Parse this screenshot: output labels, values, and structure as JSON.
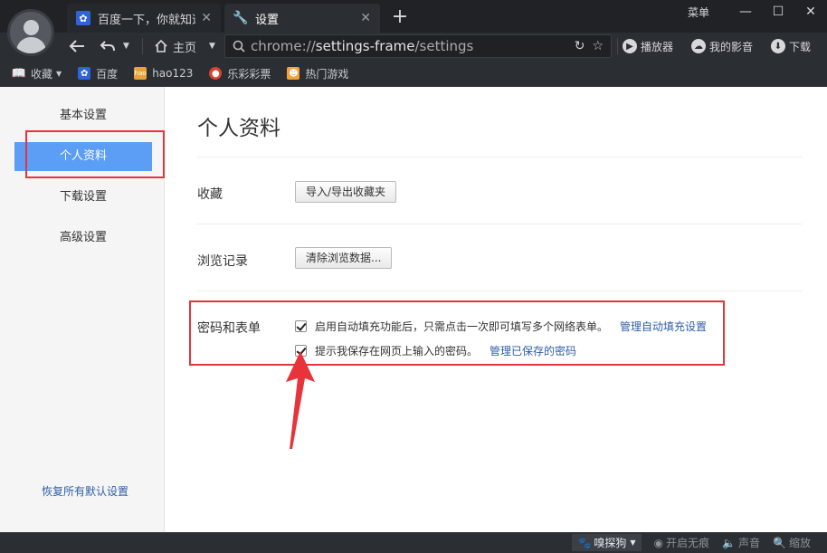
{
  "tabs": [
    {
      "title": "百度一下，你就知道",
      "favicon": "baidu-paw-icon",
      "active": false
    },
    {
      "title": "设置",
      "favicon": "wrench-icon",
      "active": true
    }
  ],
  "window": {
    "menu_label": "菜单"
  },
  "nav": {
    "home_label": "主页",
    "url_scheme": "chrome://",
    "url_host": "settings-frame",
    "url_path": "/settings",
    "tools": {
      "player": "播放器",
      "my_videos": "我的影音",
      "download": "下载"
    }
  },
  "bookmarks": [
    {
      "label": "收藏",
      "icon": "book-icon"
    },
    {
      "label": "百度",
      "icon": "baidu-paw-icon"
    },
    {
      "label": "hao123",
      "icon": "hao123-icon"
    },
    {
      "label": "乐彩彩票",
      "icon": "lottery-icon"
    },
    {
      "label": "热门游戏",
      "icon": "game-icon"
    }
  ],
  "sidebar": {
    "items": [
      {
        "label": "基本设置",
        "selected": false
      },
      {
        "label": "个人资料",
        "selected": true
      },
      {
        "label": "下载设置",
        "selected": false
      },
      {
        "label": "高级设置",
        "selected": false
      }
    ],
    "restore_label": "恢复所有默认设置"
  },
  "content": {
    "title": "个人资料",
    "favorites": {
      "label": "收藏",
      "button": "导入/导出收藏夹"
    },
    "history": {
      "label": "浏览记录",
      "button": "清除浏览数据..."
    },
    "passwords": {
      "label": "密码和表单",
      "autofill_text": "启用自动填充功能后，只需点击一次即可填写多个网络表单。",
      "autofill_link": "管理自动填充设置",
      "autofill_checked": true,
      "save_pw_text": "提示我保存在网页上输入的密码。",
      "save_pw_link": "管理已保存的密码",
      "save_pw_checked": true
    }
  },
  "statusbar": {
    "sniff": "嗅探狗",
    "incognito": "开启无痕",
    "sound": "声音",
    "zoom": "缩放"
  },
  "colors": {
    "accent": "#5c9ef5",
    "annotation": "#e8333b",
    "link": "#2d5ea8",
    "chrome": "#2b2e33"
  }
}
